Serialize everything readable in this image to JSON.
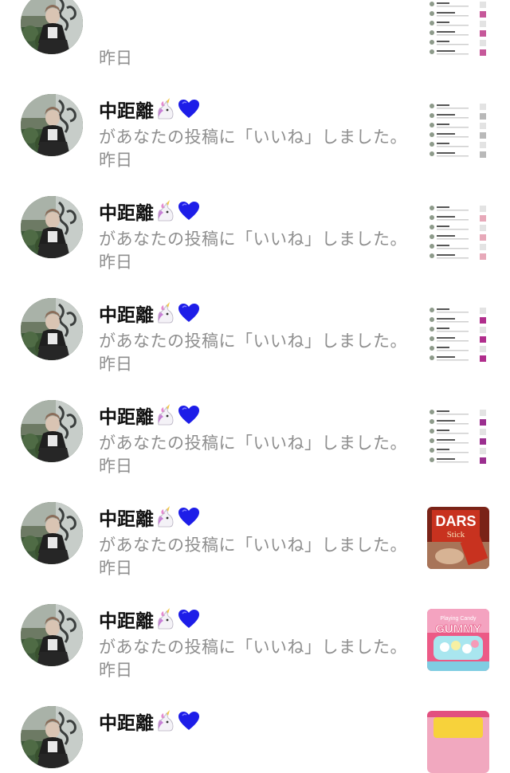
{
  "notifications": [
    {
      "user": "",
      "message": "",
      "time": "昨日",
      "thumb": "screenshot",
      "thumb_accent": "#c6589a"
    },
    {
      "user": "中距離",
      "emoji": "🦄💙",
      "message": "があなたの投稿に「いいね」しました。",
      "time": "昨日",
      "thumb": "screenshot",
      "thumb_accent": "#b9b9b9"
    },
    {
      "user": "中距離",
      "emoji": "🦄💙",
      "message": "があなたの投稿に「いいね」しました。",
      "time": "昨日",
      "thumb": "screenshot",
      "thumb_accent": "#e7a9b9"
    },
    {
      "user": "中距離",
      "emoji": "🦄💙",
      "message": "があなたの投稿に「いいね」しました。",
      "time": "昨日",
      "thumb": "screenshot",
      "thumb_accent": "#b02e8c"
    },
    {
      "user": "中距離",
      "emoji": "🦄💙",
      "message": "があなたの投稿に「いいね」しました。",
      "time": "昨日",
      "thumb": "screenshot",
      "thumb_accent": "#9b2f8f"
    },
    {
      "user": "中距離",
      "emoji": "🦄💙",
      "message": "があなたの投稿に「いいね」しました。",
      "time": "昨日",
      "thumb": "dars",
      "thumb_text": "DARS",
      "thumb_subtext": "Stick"
    },
    {
      "user": "中距離",
      "emoji": "🦄💙",
      "message": "があなたの投稿に「いいね」しました。",
      "time": "昨日",
      "thumb": "gummy",
      "thumb_text": "GUMMY"
    },
    {
      "user": "中距離",
      "emoji": "🦄💙",
      "message": "",
      "time": "",
      "thumb": "candy",
      "thumb_text": ""
    }
  ],
  "colors": {
    "name": "#111111",
    "secondary_text": "#8e8e8e",
    "heart": "#1d1de8",
    "background": "#ffffff"
  },
  "icons": {
    "avatar": "user-avatar-photo",
    "unicorn": "unicorn-emoji",
    "heart": "blue-heart-emoji"
  }
}
